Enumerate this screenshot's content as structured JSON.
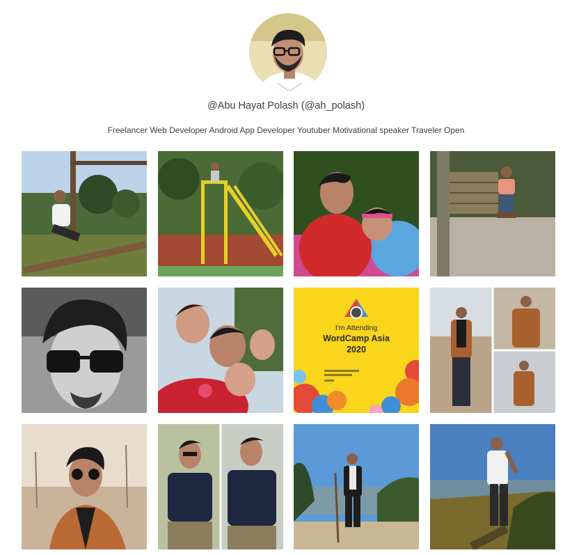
{
  "profile": {
    "username": "@Abu Hayat Polash (@ah_polash)",
    "bio": "Freelancer Web Developer Android App Developer Youtuber Motivational speaker Traveler Open"
  },
  "posts": [
    {
      "description": "photo-man-sitting-on-railing-outdoors"
    },
    {
      "description": "photo-man-jumping-on-yellow-playground-structure"
    },
    {
      "description": "photo-selfie-with-child-rickshaw"
    },
    {
      "description": "photo-man-on-swing-by-fence"
    },
    {
      "description": "photo-black-and-white-man-sunglasses"
    },
    {
      "description": "photo-selfie-with-children-flowers"
    },
    {
      "description": "wordcamp-asia-2020-badge",
      "line1": "I'm Attending",
      "line2": "WordCamp Asia",
      "line3": "2020"
    },
    {
      "description": "photo-collage-man-brown-jacket"
    },
    {
      "description": "photo-man-brown-jacket-round-sunglasses"
    },
    {
      "description": "photo-man-navy-polo-collage"
    },
    {
      "description": "photo-man-black-jacket-hilltop"
    },
    {
      "description": "photo-man-white-tshirt-hill-sunset"
    }
  ],
  "colors": {
    "text": "#3d3d3d",
    "wordcamp_yellow": "#f9d51c"
  }
}
